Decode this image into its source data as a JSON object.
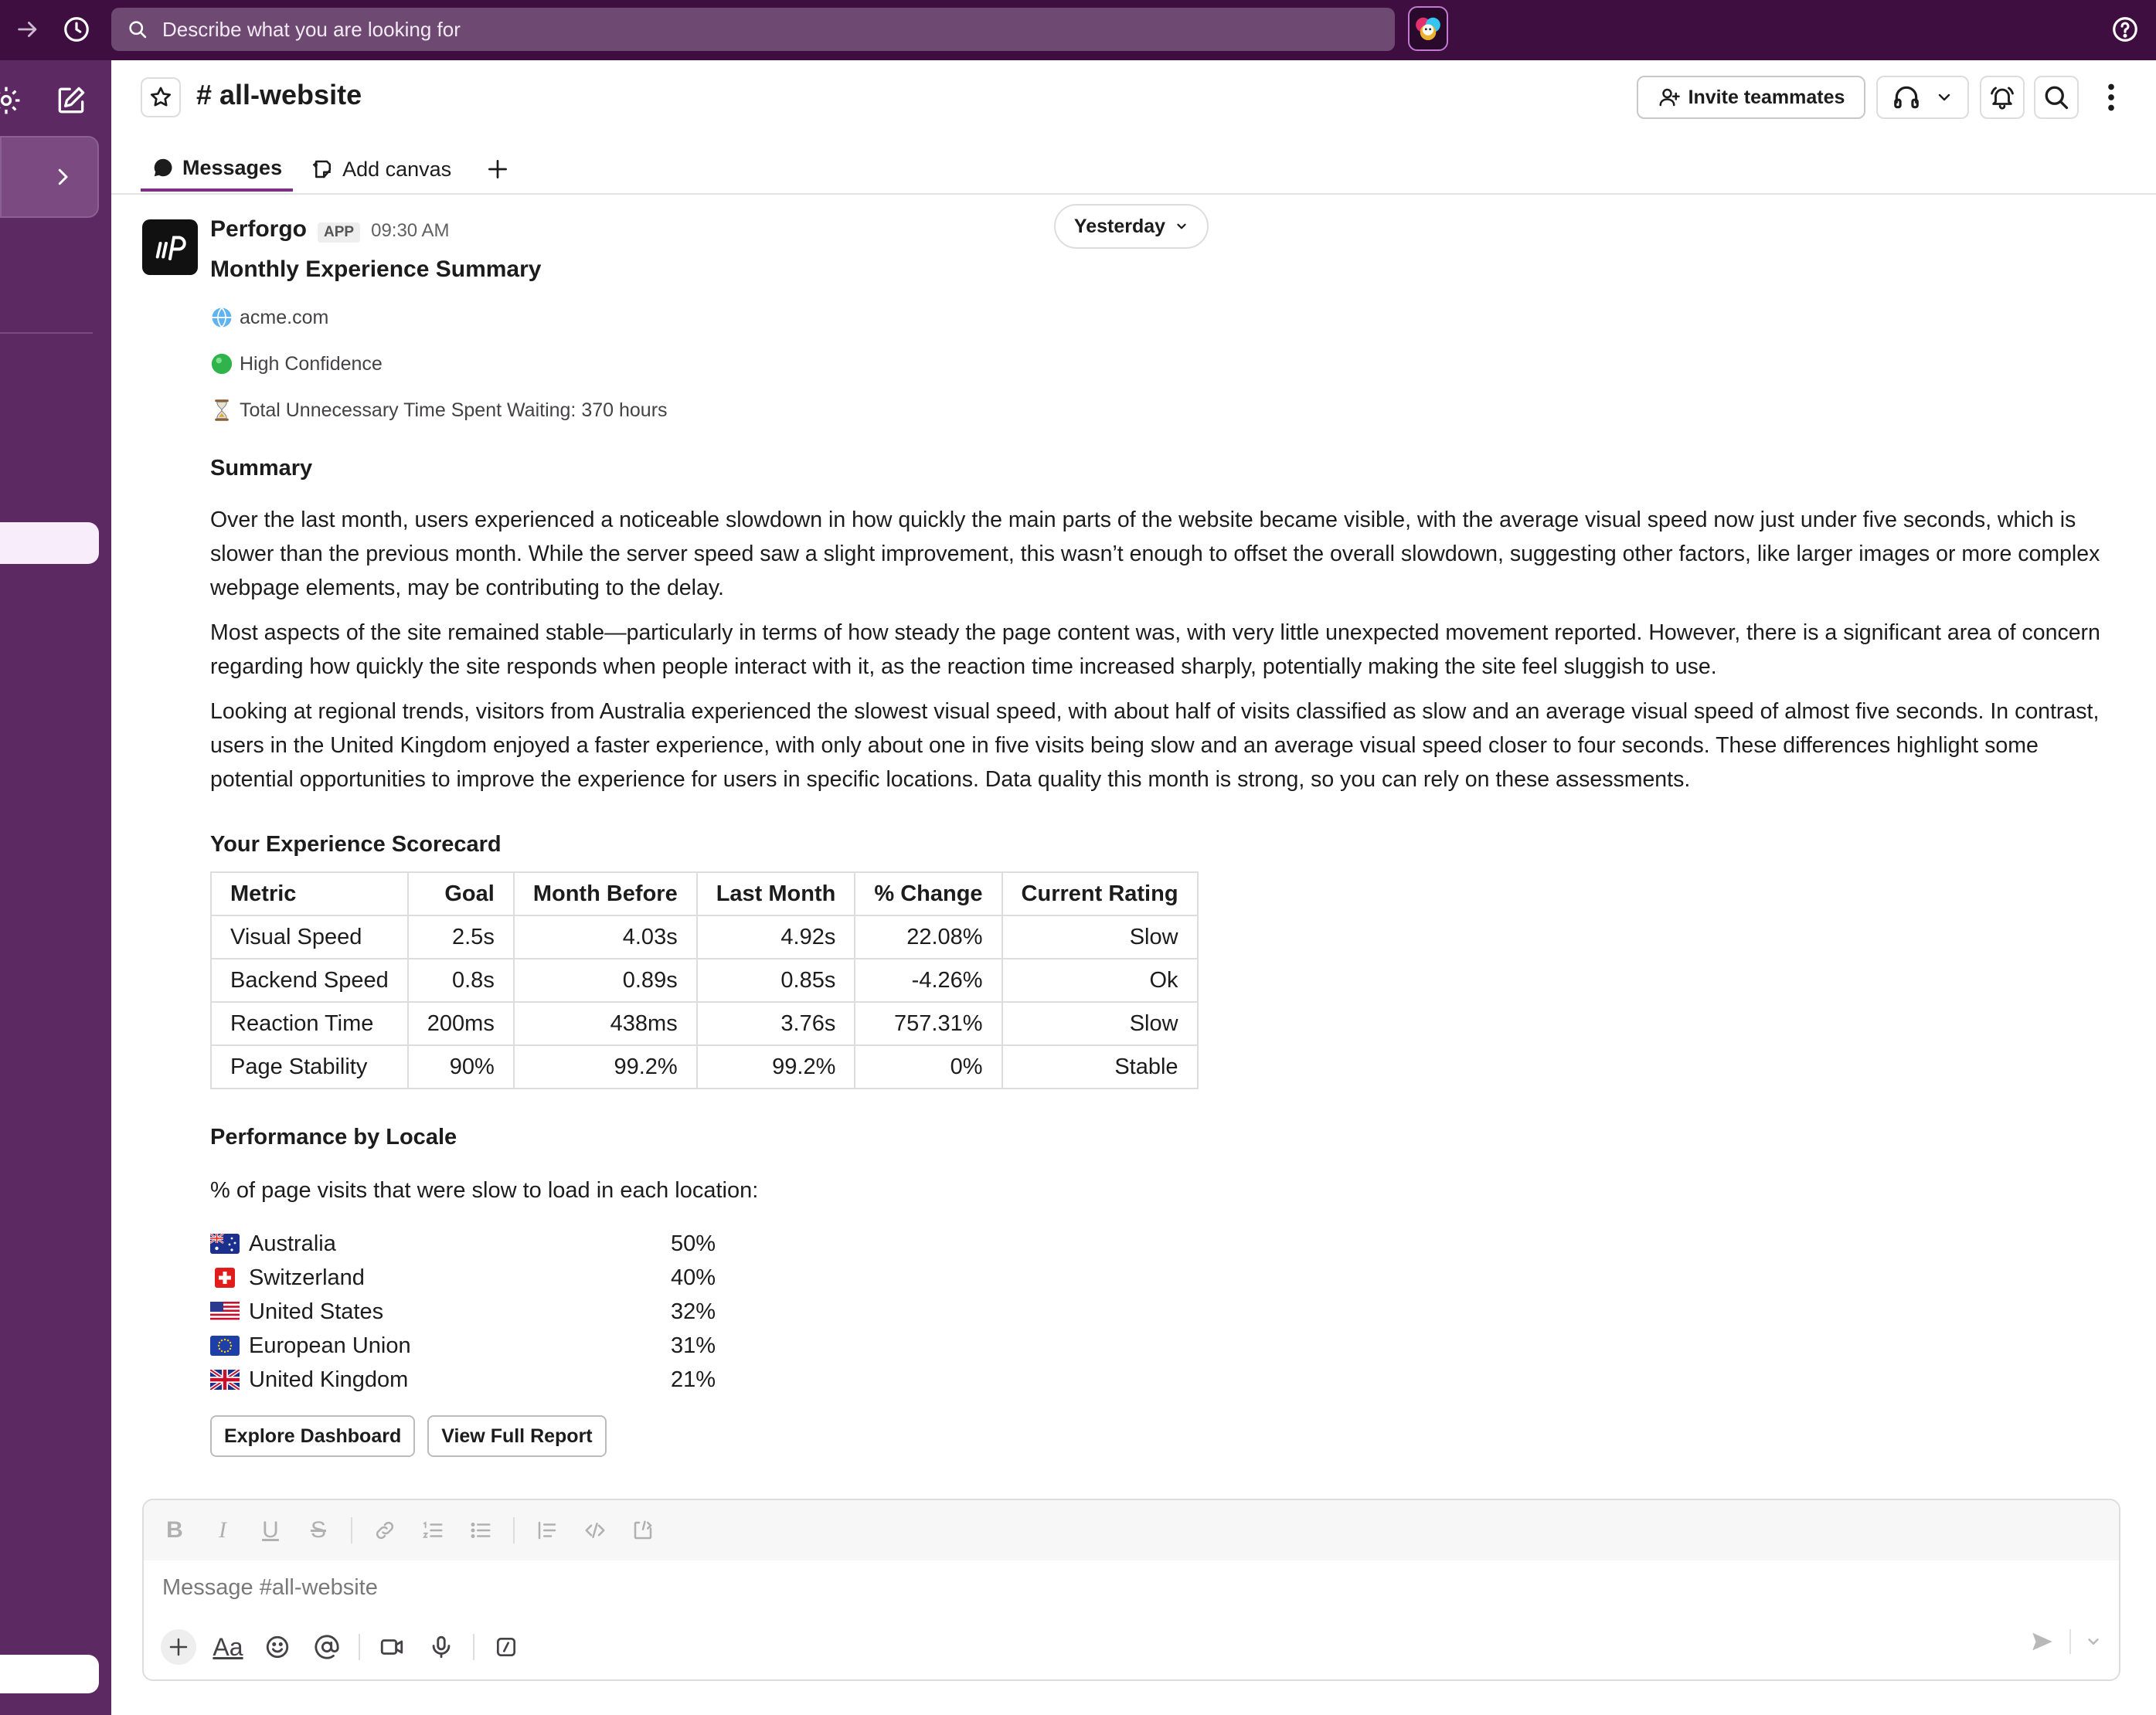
{
  "search": {
    "placeholder": "Describe what you are looking for"
  },
  "channel": {
    "title": "# all-website",
    "invite_label": "Invite teammates",
    "tabs": {
      "messages": "Messages",
      "add_canvas": "Add canvas"
    }
  },
  "date_divider": "Yesterday",
  "message": {
    "sender": "Perforgo",
    "badge": "APP",
    "time": "09:30 AM",
    "title": "Monthly Experience Summary",
    "meta": {
      "domain": "acme.com",
      "confidence": "High Confidence",
      "waiting": "Total Unnecessary Time Spent Waiting: 370 hours"
    },
    "summary_heading": "Summary",
    "paragraphs": [
      "Over the last month, users experienced a noticeable slowdown in how quickly the main parts of the website became visible, with the average visual speed now just under five seconds, which is slower than the previous month. While the server speed saw a slight improvement, this wasn’t enough to offset the overall slowdown, suggesting other factors, like larger images or more complex webpage elements, may be contributing to the delay.",
      "Most aspects of the site remained stable—particularly in terms of how steady the page content was, with very little unexpected movement reported. However, there is a significant area of concern regarding how quickly the site responds when people interact with it, as the reaction time increased sharply, potentially making the site feel sluggish to use.",
      "Looking at regional trends, visitors from Australia experienced the slowest visual speed, with about half of visits classified as slow and an average visual speed of almost five seconds. In contrast, users in the United Kingdom enjoyed a faster experience, with only about one in five visits being slow and an average visual speed closer to four seconds. These differences highlight some potential opportunities to improve the experience for users in specific locations. Data quality this month is strong, so you can rely on these assessments."
    ],
    "scorecard": {
      "heading": "Your Experience Scorecard",
      "columns": [
        "Metric",
        "Goal",
        "Month Before",
        "Last Month",
        "% Change",
        "Current Rating"
      ],
      "rows": [
        [
          "Visual Speed",
          "2.5s",
          "4.03s",
          "4.92s",
          "22.08%",
          "Slow"
        ],
        [
          "Backend Speed",
          "0.8s",
          "0.89s",
          "0.85s",
          "-4.26%",
          "Ok"
        ],
        [
          "Reaction Time",
          "200ms",
          "438ms",
          "3.76s",
          "757.31%",
          "Slow"
        ],
        [
          "Page Stability",
          "90%",
          "99.2%",
          "99.2%",
          "0%",
          "Stable"
        ]
      ]
    },
    "locale": {
      "heading": "Performance by Locale",
      "intro": "% of page visits that were slow to load in each location:",
      "rows": [
        {
          "flag": "flag-australia-icon",
          "name": "Australia",
          "value": "50%"
        },
        {
          "flag": "flag-switzerland-icon",
          "name": "Switzerland",
          "value": "40%"
        },
        {
          "flag": "flag-united-states-icon",
          "name": "United States",
          "value": "32%"
        },
        {
          "flag": "flag-european-union-icon",
          "name": "European Union",
          "value": "31%"
        },
        {
          "flag": "flag-united-kingdom-icon",
          "name": "United Kingdom",
          "value": "21%"
        }
      ]
    },
    "actions": {
      "explore": "Explore Dashboard",
      "report": "View Full Report"
    }
  },
  "composer": {
    "placeholder": "Message #all-website",
    "aa_label": "Aa"
  },
  "colors": {
    "topbar": "#3f0e40",
    "leftrail": "#5d2963",
    "search_bg": "#6e4a72",
    "tab_underline": "#7c3085"
  }
}
